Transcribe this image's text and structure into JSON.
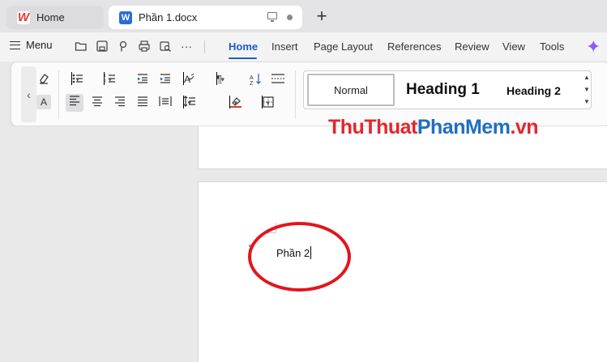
{
  "tabs": {
    "home_label": "Home",
    "doc_label": "Phần 1.docx",
    "new_tab": "+"
  },
  "menubar": {
    "menu_label": "Menu",
    "more": "···",
    "tabs": [
      "Home",
      "Insert",
      "Page Layout",
      "References",
      "Review",
      "View",
      "Tools"
    ],
    "active_tab": "Home"
  },
  "ribbon": {
    "styles": {
      "normal": "Normal",
      "heading1": "Heading 1",
      "heading2": "Heading 2"
    }
  },
  "document": {
    "text": "Phần 2"
  },
  "watermark": {
    "part1": "ThuThuat",
    "part2": "PhanMem",
    "part3": ".vn"
  },
  "colors": {
    "accent": "#1e5bc6",
    "highlight": "#e3151c"
  }
}
